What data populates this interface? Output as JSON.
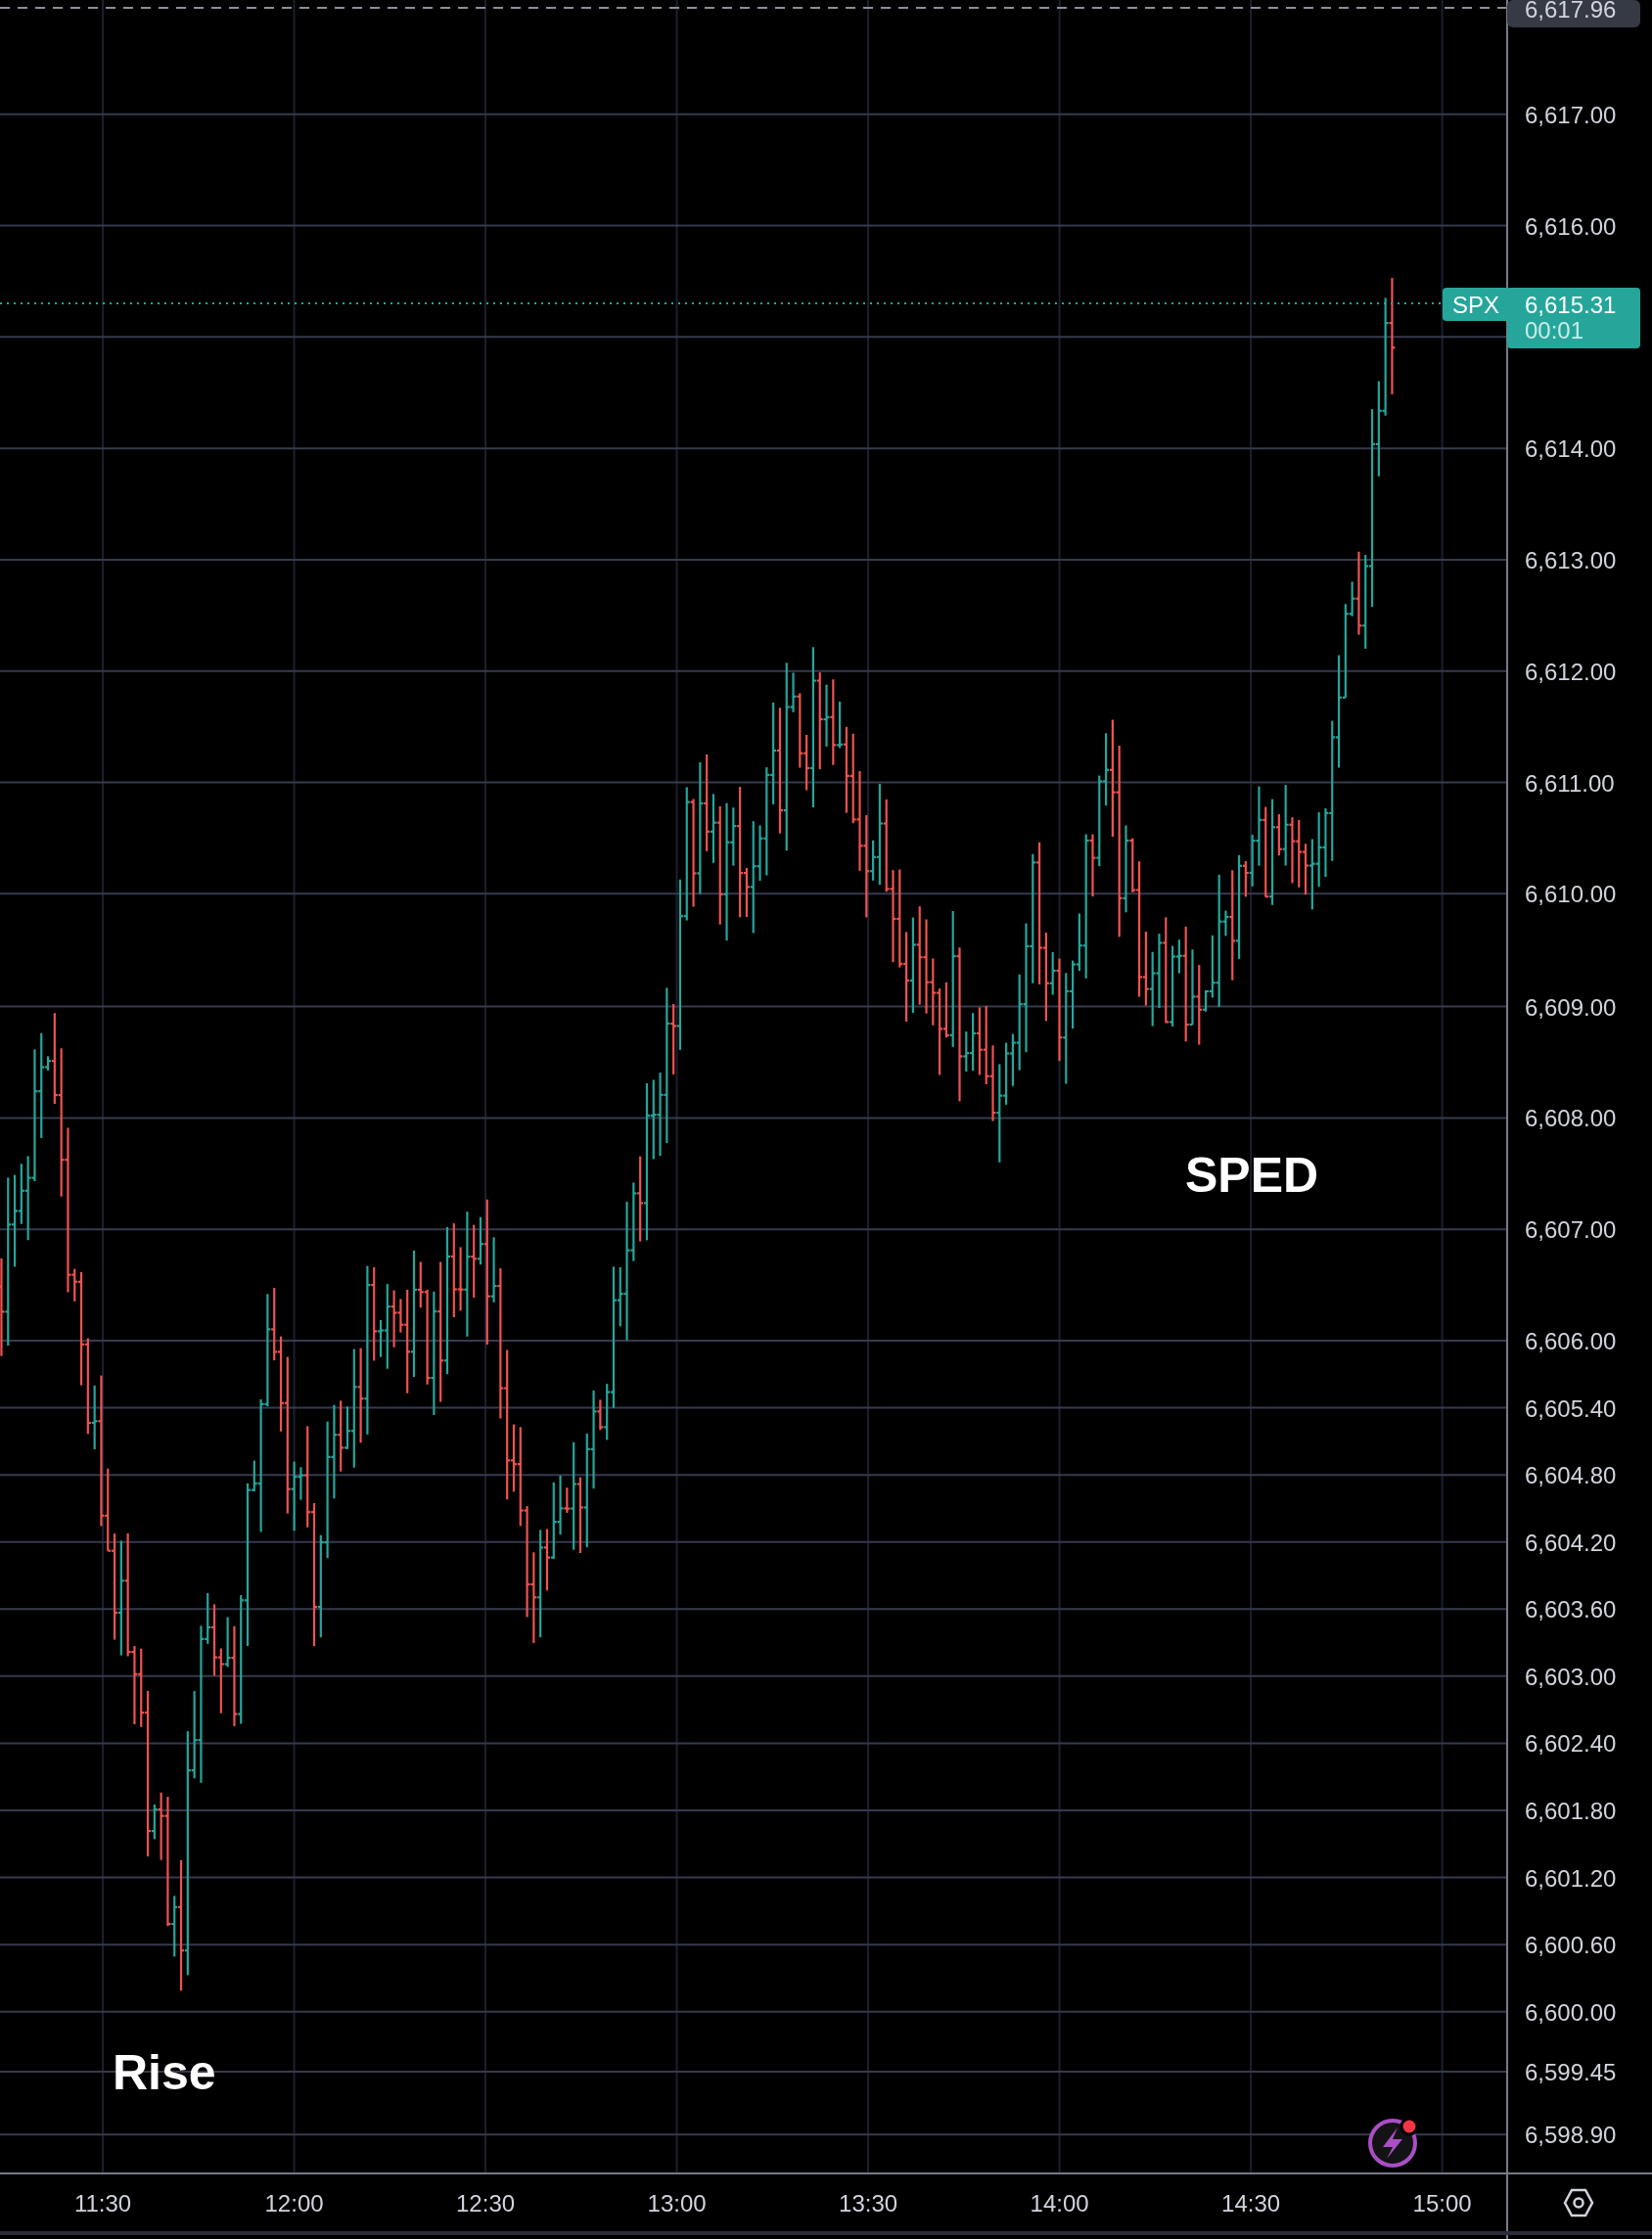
{
  "price_axis": {
    "labels": [
      "6,617.00",
      "6,616.00",
      "6,614.00",
      "6,613.00",
      "6,612.00",
      "6,611.00",
      "6,610.00",
      "6,609.00",
      "6,608.00",
      "6,607.00",
      "6,606.00",
      "6,605.40",
      "6,604.80",
      "6,604.20",
      "6,603.60",
      "6,603.00",
      "6,602.40",
      "6,601.80",
      "6,601.20",
      "6,600.60",
      "6,600.00",
      "6,599.45",
      "6,598.90"
    ]
  },
  "crosshair_label": "6,617.96",
  "last_price": {
    "symbol": "SPX",
    "price": "6,615.31",
    "countdown": "00:01"
  },
  "time_axis": {
    "labels": [
      "11:30",
      "12:00",
      "12:30",
      "13:00",
      "13:30",
      "14:00",
      "14:30",
      "15:00"
    ]
  },
  "annotations": [
    "SPED",
    "Rise"
  ]
}
